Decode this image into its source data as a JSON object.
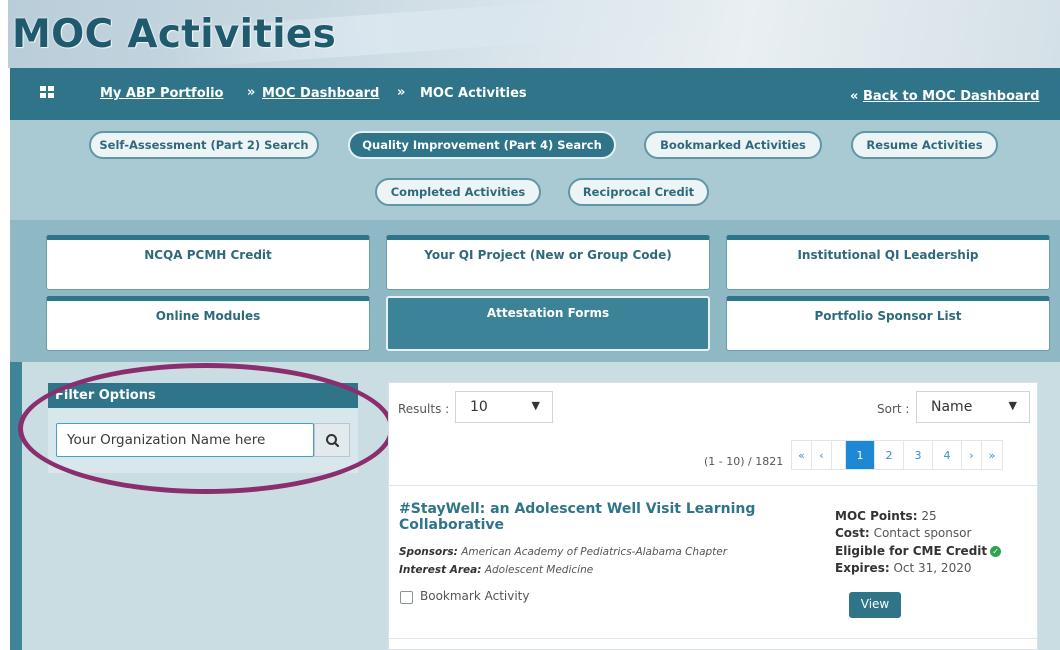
{
  "header": {
    "title": "MOC Activities"
  },
  "breadcrumb": {
    "items": [
      "My ABP Portfolio",
      "MOC Dashboard",
      "MOC Activities"
    ],
    "separator": "»",
    "back_arrow": "«",
    "back_link": "Back to MOC Dashboard"
  },
  "tabs": [
    "Self-Assessment (Part 2) Search",
    "Quality Improvement (Part 4) Search",
    "Bookmarked Activities",
    "Resume Activities",
    "Completed Activities",
    "Reciprocal Credit"
  ],
  "cards": [
    "NCQA PCMH Credit",
    "Your QI Project (New or Group Code)",
    "Institutional QI Leadership",
    "Online Modules",
    "Attestation Forms",
    "Portfolio Sponsor List"
  ],
  "filter": {
    "heading": "Filter Options",
    "search_value": "Your Organization Name here"
  },
  "results": {
    "label": "Results :",
    "per_page": "10",
    "sort_label": "Sort :",
    "sort_value": "Name",
    "range": "(1 - 10) / 1821",
    "pages": [
      "«",
      "‹",
      "1",
      "2",
      "3",
      "4",
      "›",
      "»"
    ],
    "current_page": "1"
  },
  "activity": {
    "title": "#StayWell: an Adolescent Well Visit Learning Collaborative",
    "sponsors_label": "Sponsors:",
    "sponsors": "American Academy of Pediatrics-Alabama Chapter",
    "interest_label": "Interest Area:",
    "interest": "Adolescent Medicine",
    "bookmark_label": "Bookmark Activity",
    "moc_points_label": "MOC Points:",
    "moc_points": "25",
    "cost_label": "Cost:",
    "cost": "Contact sponsor",
    "cme_label": "Eligible for CME Credit",
    "expires_label": "Expires:",
    "expires": "Oct 31, 2020",
    "view_label": "View"
  },
  "colors": {
    "primary": "#2f7488",
    "highlight": "#8b2e6e",
    "link": "#1e88d4",
    "success": "#2ea44f"
  }
}
